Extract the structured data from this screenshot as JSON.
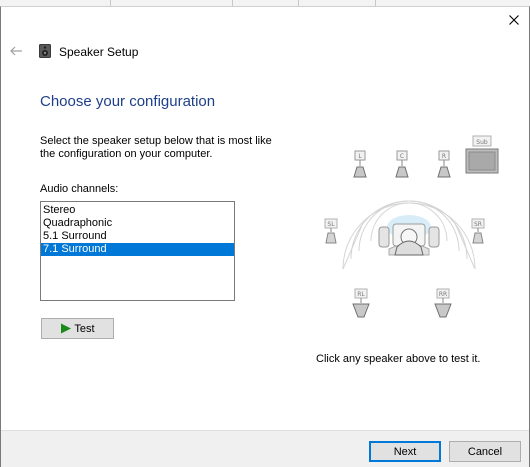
{
  "window": {
    "title": "Speaker Setup"
  },
  "main": {
    "heading": "Choose your configuration",
    "instructions": "Select the speaker setup below that is most like the configuration on your computer.",
    "audio_channels_label": "Audio channels:",
    "channels": [
      {
        "label": "Stereo",
        "selected": false
      },
      {
        "label": "Quadraphonic",
        "selected": false
      },
      {
        "label": "5.1 Surround",
        "selected": false
      },
      {
        "label": "7.1 Surround",
        "selected": true
      }
    ],
    "test_label": "Test",
    "hint": "Click any speaker above to test it."
  },
  "speakers": {
    "front_left": "L",
    "center": "C",
    "front_right": "R",
    "subwoofer": "Sub",
    "side_left": "SL",
    "side_right": "SR",
    "rear_left": "RL",
    "rear_right": "RR"
  },
  "footer": {
    "next_label": "Next",
    "cancel_label": "Cancel"
  },
  "colors": {
    "heading": "#1e3f8a",
    "selection": "#0078d7",
    "test_arrow": "#1a8a1a"
  },
  "icons": {
    "close": "close-icon",
    "back": "back-arrow-icon",
    "app": "speaker-icon",
    "test": "play-icon"
  }
}
